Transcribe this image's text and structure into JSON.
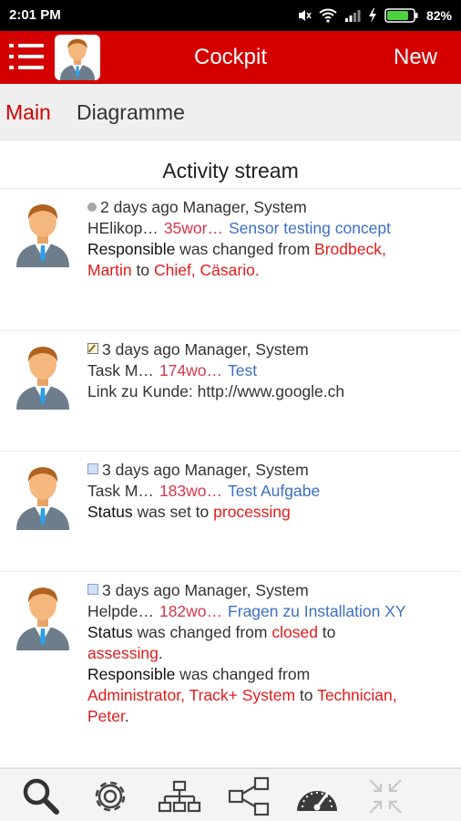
{
  "status_bar": {
    "time": "2:01 PM",
    "battery_pct": "82%",
    "battery_level": 0.82
  },
  "app_bar": {
    "title": "Cockpit",
    "new_label": "New"
  },
  "tabs": [
    {
      "label": "Main",
      "active": true
    },
    {
      "label": "Diagramme",
      "active": false
    }
  ],
  "stream_title": "Activity stream",
  "entries": [
    {
      "icon": "status-dot-icon",
      "when": "2 days ago",
      "who": "Manager, System",
      "item_title": "HElikop…",
      "item_ref": "35wor…",
      "item_link": "Sensor testing concept",
      "line3_label": "Responsible",
      "line3_text": " was changed from ",
      "line3_from": "Brodbeck,",
      "line4_from_cont": "Martin",
      "line4_text": " to ",
      "line4_to": "Chief, Cäsario."
    },
    {
      "icon": "edit-note-icon",
      "when": "3 days ago",
      "who": "Manager, System",
      "item_title": "Task M…",
      "item_ref": "174wo…",
      "item_link": "Test",
      "line3_text": "Link zu Kunde: http://www.google.ch"
    },
    {
      "icon": "task-icon",
      "when": "3 days ago",
      "who": "Manager, System",
      "item_title": "Task M…",
      "item_ref": "183wo…",
      "item_link": "Test Aufgabe",
      "line3_label": "Status",
      "line3_text": " was set to ",
      "line3_value": "processing"
    },
    {
      "icon": "task-icon",
      "when": "3 days ago",
      "who": "Manager, System",
      "item_title": "Helpde…",
      "item_ref": "182wo…",
      "item_link": "Fragen zu Installation XY",
      "line3_label": "Status",
      "line3_text": " was changed from ",
      "line3_from": "closed",
      "line3_to_word": " to",
      "line4_to": "assessing",
      "line4_end": ".",
      "line5_label": "Responsible",
      "line5_text": " was changed from",
      "line6_from": "Administrator, Track+ System",
      "line6_text": " to ",
      "line6_to": "Technician,",
      "line7_to_cont": "Peter",
      "line7_end": "."
    }
  ],
  "bottom_nav": [
    {
      "icon": "search-icon"
    },
    {
      "icon": "gear-icon"
    },
    {
      "icon": "hierarchy-icon"
    },
    {
      "icon": "share-network-icon"
    },
    {
      "icon": "dashboard-gauge-icon"
    },
    {
      "icon": "collapse-arrows-icon",
      "disabled": true
    }
  ],
  "colors": {
    "primary": "#d40000",
    "accent_red": "#e41b1b",
    "link_blue": "#3d6fc4",
    "ref_pink": "#d8364a"
  }
}
